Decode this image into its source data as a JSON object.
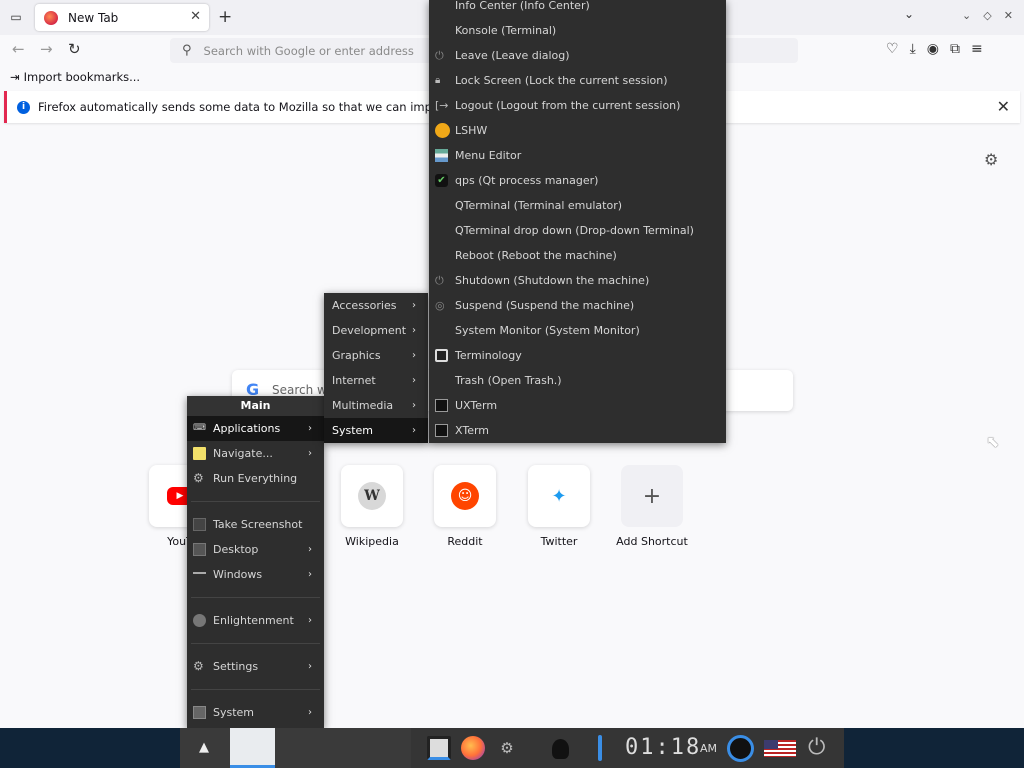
{
  "browser": {
    "tab": {
      "title": "New Tab"
    },
    "urlbar": {
      "placeholder": "Search with Google or enter address"
    },
    "bookmarks": {
      "import_label": "Import bookmarks..."
    },
    "notification": {
      "text": "Firefox automatically sends some data to Mozilla so that we can improve your exp"
    },
    "newtab": {
      "search_label": "Search w",
      "shortcuts": [
        {
          "label": "YouT",
          "icon": "youtube-icon"
        },
        {
          "label": "Wikipedia",
          "icon": "wikipedia-icon"
        },
        {
          "label": "Reddit",
          "icon": "reddit-icon"
        },
        {
          "label": "Twitter",
          "icon": "twitter-icon"
        },
        {
          "label": "Add Shortcut",
          "icon": "plus-icon"
        }
      ]
    }
  },
  "main_menu": {
    "title": "Main",
    "items": {
      "applications": "Applications",
      "navigate": "Navigate...",
      "run_everything": "Run Everything",
      "take_screenshot": "Take Screenshot",
      "desktop": "Desktop",
      "windows": "Windows",
      "enlightenment": "Enlightenment",
      "settings": "Settings",
      "system": "System"
    }
  },
  "applications_menu": {
    "items": [
      "Accessories",
      "Development",
      "Graphics",
      "Internet",
      "Multimedia",
      "System"
    ]
  },
  "system_menu": {
    "items": [
      "Info Center (Info Center)",
      "Konsole (Terminal)",
      "Leave (Leave dialog)",
      "Lock Screen (Lock the current session)",
      "Logout (Logout from the current session)",
      "LSHW",
      "Menu Editor",
      "qps (Qt process manager)",
      "QTerminal (Terminal emulator)",
      "QTerminal drop down (Drop-down Terminal)",
      "Reboot (Reboot the machine)",
      "Shutdown (Shutdown the machine)",
      "Suspend (Suspend the machine)",
      "System Monitor (System Monitor)",
      "Terminology",
      "Trash (Open Trash.)",
      "UXTerm",
      "XTerm"
    ]
  },
  "shelf": {
    "clock_digits": "01:18",
    "clock_ampm": "AM"
  },
  "colors": {
    "menu_bg": "#2e2e2e",
    "menu_selected": "#161616",
    "shelf_bg": "#102438",
    "accent_blue": "#3a8ee6"
  }
}
